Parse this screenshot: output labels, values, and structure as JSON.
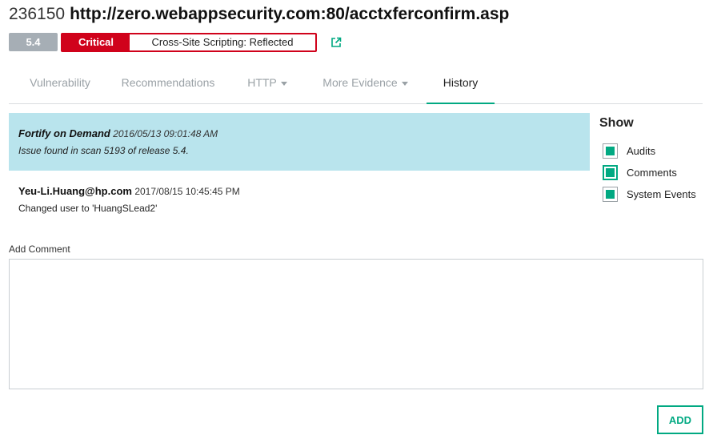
{
  "header": {
    "issue_id": "236150",
    "url": "http://zero.webappsecurity.com:80/acctxferconfirm.asp"
  },
  "badges": {
    "score": "5.4",
    "severity": "Critical",
    "category": "Cross-Site Scripting: Reflected",
    "external_link_icon": "external-link-icon"
  },
  "tabs": [
    {
      "label": "Vulnerability",
      "dropdown": false
    },
    {
      "label": "Recommendations",
      "dropdown": false
    },
    {
      "label": "HTTP",
      "dropdown": true
    },
    {
      "label": "More Evidence",
      "dropdown": true
    },
    {
      "label": "History",
      "dropdown": false,
      "active": true
    }
  ],
  "history": [
    {
      "author": "Fortify on Demand",
      "timestamp": "2016/05/13 09:01:48 AM",
      "message": "Issue found in scan 5193 of release 5.4.",
      "highlighted": true
    },
    {
      "author": "Yeu-Li.Huang@hp.com",
      "timestamp": "2017/08/15 10:45:45 PM",
      "message": "Changed user to 'HuangSLead2'",
      "highlighted": false
    }
  ],
  "show_filter": {
    "title": "Show",
    "options": [
      {
        "label": "Audits",
        "checked": true
      },
      {
        "label": "Comments",
        "checked": true,
        "focused": true
      },
      {
        "label": "System Events",
        "checked": true
      }
    ]
  },
  "comment": {
    "label": "Add Comment",
    "value": "",
    "button_label": "ADD"
  },
  "colors": {
    "accent": "#01a982",
    "critical": "#d0021b",
    "highlight_row": "#b9e4ed",
    "score_badge": "#a6aeb5"
  }
}
